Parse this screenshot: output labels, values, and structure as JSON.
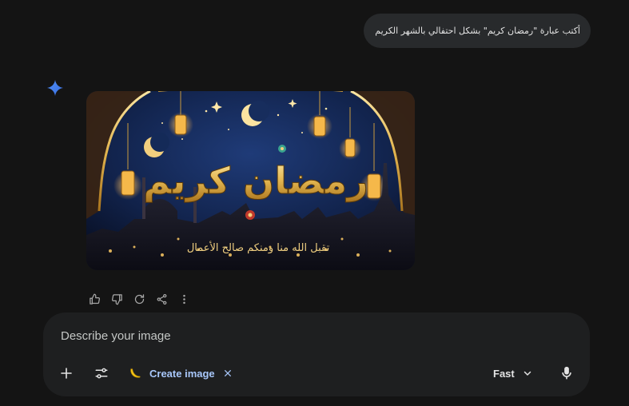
{
  "conversation": {
    "user_message": "أكتب عبارة \"رمضان كريم\" بشكل احتفالي بالشهر الكريم",
    "response_image": {
      "alt": "Ramadan Kareem illustration",
      "calligraphy_main": "رمضان كريم",
      "calligraphy_sub": "تقبل الله منا ومنكم صالح الأعمال"
    },
    "actions": [
      {
        "name": "thumbs-up-icon"
      },
      {
        "name": "thumbs-down-icon"
      },
      {
        "name": "redo-icon"
      },
      {
        "name": "share-icon"
      },
      {
        "name": "more-vertical-icon"
      }
    ]
  },
  "composer": {
    "placeholder": "Describe your image",
    "value": "",
    "tool_chip": {
      "icon": "banana-icon",
      "label": "Create image",
      "close": "×"
    },
    "mode": {
      "label": "Fast"
    }
  },
  "colors": {
    "background": "#141414",
    "bubble": "#282a2c",
    "composer": "#1e1f20",
    "accent": "#a8c7fa",
    "spark": "#4285f4",
    "gold": "#e9c46a"
  }
}
